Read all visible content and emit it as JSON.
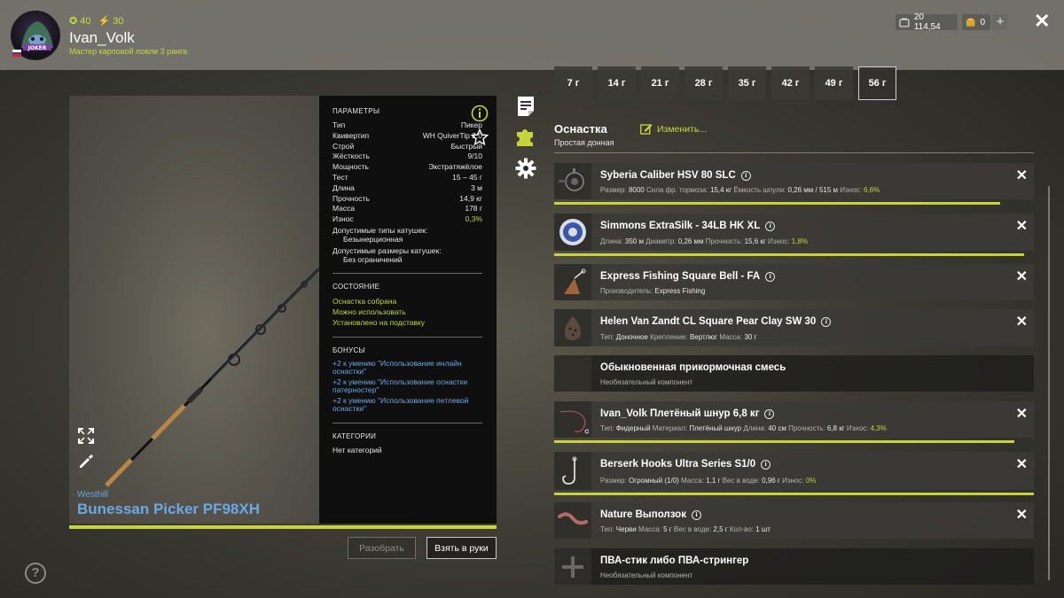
{
  "player": {
    "stat_a": "40",
    "stat_b": "30",
    "username": "Ivan_Volk",
    "rank": "Мастер карповой ловли 3 ранга",
    "avatar_text": "JOKER"
  },
  "wallet": {
    "money": "20 114,54",
    "gold": "0"
  },
  "weights": [
    {
      "label": "7 г"
    },
    {
      "label": "14 г"
    },
    {
      "label": "21 г"
    },
    {
      "label": "28 г"
    },
    {
      "label": "35 г"
    },
    {
      "label": "42 г"
    },
    {
      "label": "49 г"
    },
    {
      "label": "56 г",
      "active": true
    }
  ],
  "rod": {
    "brand": "Westhill",
    "name": "Bunessan Picker PF98XH",
    "durability_fraction": 1.0
  },
  "params": {
    "title": "ПАРАМЕТРЫ",
    "rows": [
      {
        "k": "Тип",
        "v": "Пикер"
      },
      {
        "k": "Квивертип",
        "v": "WH QuiverTip 2.0"
      },
      {
        "k": "Строй",
        "v": "Быстрый"
      },
      {
        "k": "Жёсткость",
        "v": "9/10"
      },
      {
        "k": "Мощность",
        "v": "Экстратяжёлое"
      },
      {
        "k": "Тест",
        "v": "15 – 45 г"
      },
      {
        "k": "Длина",
        "v": "3 м"
      },
      {
        "k": "Прочность",
        "v": "14,9 кг"
      },
      {
        "k": "Масса",
        "v": "178 г"
      },
      {
        "k": "Износ",
        "v": "0,3%"
      }
    ],
    "reel_types_label": "Допустимые типы катушек:",
    "reel_types_value": "Безынерционная",
    "reel_sizes_label": "Допустимые размеры катушек:",
    "reel_sizes_value": "Без ограничений",
    "state_title": "СОСТОЯНИЕ",
    "states": [
      "Оснастка собрана",
      "Можно использовать",
      "Установлено на подставку"
    ],
    "bonus_title": "БОНУСЫ",
    "bonuses": [
      "+2 к умению \"Использование инлайн оснастки\"",
      "+2 к умению \"Использование оснастки патерностер\"",
      "+2 к умению \"Использование петлевой оснастки\""
    ],
    "cat_title": "КАТЕГОРИИ",
    "cat_value": "Нет категорий"
  },
  "buttons": {
    "disassemble": "Разобрать",
    "take": "Взять в руки"
  },
  "rig": {
    "title": "Оснастка",
    "subtitle": "Простая донная",
    "edit": "Изменить..."
  },
  "items": [
    {
      "name": "Syberia Caliber HSV 80 SLC",
      "info": true,
      "removable": true,
      "icon": "reel-icon",
      "details": [
        [
          "Размер:",
          "8000"
        ],
        [
          "Сила фр. тормоза:",
          "15,4 кг"
        ],
        [
          "Ёмкость шпули:",
          "0,26 мм / 515 м"
        ],
        [
          "Износ:",
          "6,6%",
          "g"
        ]
      ],
      "durability": 0.93
    },
    {
      "name": "Simmons ExtraSilk - 34LB HK XL",
      "info": true,
      "removable": true,
      "icon": "line-spool-icon",
      "details": [
        [
          "Длина:",
          "350 м"
        ],
        [
          "Диаметр:",
          "0,26 мм"
        ],
        [
          "Прочность:",
          "15,6 кг"
        ],
        [
          "Износ:",
          "1,8%",
          "g"
        ]
      ],
      "durability": 0.98
    },
    {
      "name": "Express Fishing Square Bell - FA",
      "info": true,
      "removable": true,
      "icon": "bell-icon",
      "details": [
        [
          "Производитель:",
          "Express Fishing"
        ]
      ],
      "durability": null
    },
    {
      "name": "Helen Van Zandt CL Square Pear Clay SW 30",
      "info": true,
      "removable": true,
      "icon": "feeder-icon",
      "details": [
        [
          "Тип:",
          "Доночное"
        ],
        [
          "Крепление:",
          "Вертлюг"
        ],
        [
          "Масса:",
          "30 г"
        ]
      ],
      "durability": null
    },
    {
      "name": "Обыкновенная прикормочная смесь",
      "info": false,
      "removable": false,
      "icon": "empty-slot",
      "details": [
        [
          "Необязательный компонент",
          ""
        ]
      ],
      "durability": null,
      "empty": true
    },
    {
      "name": "Ivan_Volk Плетёный шнур 6,8 кг",
      "info": true,
      "removable": true,
      "icon": "leader-icon",
      "details": [
        [
          "Тип:",
          "Фидерный"
        ],
        [
          "Материал:",
          "Плетёный шнур"
        ],
        [
          "Длина:",
          "40 см"
        ],
        [
          "Прочность:",
          "6,8 кг"
        ],
        [
          "Износ:",
          "4,3%",
          "g"
        ]
      ],
      "durability": 0.96
    },
    {
      "name": "Berserk Hooks Ultra Series S1/0",
      "info": true,
      "removable": true,
      "icon": "hook-icon",
      "details": [
        [
          "Размер:",
          "Огромный (1/0)"
        ],
        [
          "Масса:",
          "1,1 г"
        ],
        [
          "Вес в воде:",
          "0,96 г"
        ],
        [
          "Износ:",
          "0%",
          "g"
        ]
      ],
      "durability": 1.0
    },
    {
      "name": "Nature Выползок",
      "info": true,
      "removable": true,
      "icon": "worm-icon",
      "details": [
        [
          "Тип:",
          "Черви"
        ],
        [
          "Масса:",
          "5 г"
        ],
        [
          "Вес в воде:",
          "2,5 г"
        ],
        [
          "Кол-во:",
          "1 шт"
        ]
      ],
      "durability": null
    },
    {
      "name": "ПВА-стик либо ПВА-стрингер",
      "info": false,
      "removable": false,
      "icon": "add-icon",
      "details": [
        [
          "Необязательный компонент",
          ""
        ]
      ],
      "durability": null,
      "empty": true
    }
  ],
  "help": "?",
  "colors": {
    "accent": "#c4d43a",
    "link": "#6aa9e4",
    "panel": "#0f0f0f"
  }
}
